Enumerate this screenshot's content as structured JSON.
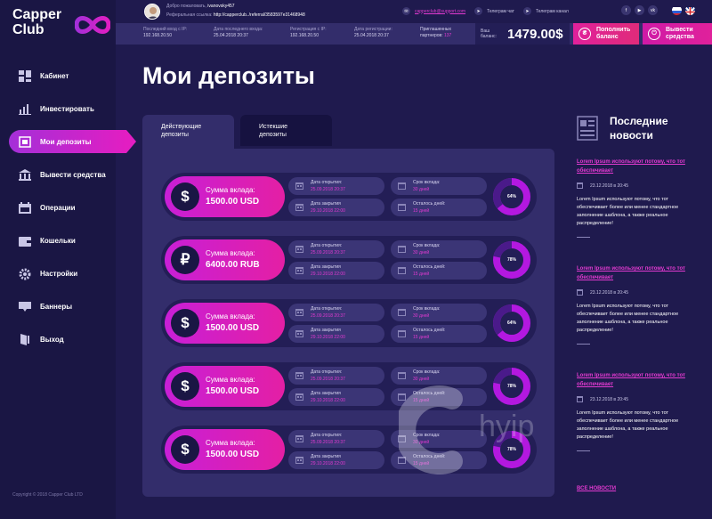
{
  "brand": {
    "line1": "Capper",
    "line2": "Club",
    "accent": "#e21ec2",
    "accent_purple": "#a42fd8"
  },
  "sidebar": {
    "items": [
      {
        "label": "Кабинет",
        "icon": "dashboard-icon",
        "active": false
      },
      {
        "label": "Инвестировать",
        "icon": "invest-icon",
        "active": false
      },
      {
        "label": "Мои депозиты",
        "icon": "deposits-icon",
        "active": true
      },
      {
        "label": "Вывести средства",
        "icon": "withdraw-icon",
        "active": false
      },
      {
        "label": "Операции",
        "icon": "operations-icon",
        "active": false
      },
      {
        "label": "Кошельки",
        "icon": "wallet-icon",
        "active": false
      },
      {
        "label": "Настройки",
        "icon": "gear-icon",
        "active": false
      },
      {
        "label": "Баннеры",
        "icon": "banner-icon",
        "active": false
      },
      {
        "label": "Выход",
        "icon": "logout-icon",
        "active": false
      }
    ],
    "copyright": "Copyright © 2018 Capper Club LTD"
  },
  "topbar": {
    "welcome_label": "Добро пожаловать,",
    "username": "ivanovsky457",
    "ref_label": "Реферальная ссылка:",
    "ref_url": "http://capperclub../referral/3583597e31468948",
    "email": "capperclub@support.com",
    "telegram_chat": "Телеграм чат",
    "telegram_channel": "Телеграм канал",
    "socials": [
      "f",
      "▶",
      "vk"
    ]
  },
  "stats": {
    "last_login_ip_label": "Последний вход с IP:",
    "last_login_ip": "192.168.20.50",
    "last_login_date_label": "Дата последнего входа:",
    "last_login_date": "25.04.2018   20:37",
    "reg_ip_label": "Регистрация с IP:",
    "reg_ip": "192.168.20.50",
    "reg_date_label": "Дата регистрации:",
    "reg_date": "25.04.2018   20:37",
    "partners_label1": "Приглашенных",
    "partners_label2": "партнеров:",
    "partners_count": "137",
    "balance_label1": "Ваш",
    "balance_label2": "баланс:",
    "balance_value": "1479.00$",
    "topup_label1": "Пополнить",
    "topup_label2": "баланс",
    "withdraw_label1": "Вывести",
    "withdraw_label2": "средства"
  },
  "main": {
    "title": "Мои депозиты",
    "tabs": [
      {
        "line1": "Действующие",
        "line2": "депозиты",
        "active": true
      },
      {
        "line1": "Истекшие",
        "line2": "депозиты",
        "active": false
      }
    ],
    "labels": {
      "amount": "Сумма вклада:",
      "open_date": "Дата открытия:",
      "close_date": "Дата закрытия",
      "term": "Срок вклада:",
      "days_left": "Осталось дней:"
    },
    "deposits": [
      {
        "currency_icon": "$",
        "amount": "1500.00 USD",
        "open": "25.09.2018  20:37",
        "close": "29.10.2018  22:00",
        "term": "30 дней",
        "left": "15 дней",
        "progress": 64,
        "progress_label": "64%"
      },
      {
        "currency_icon": "₽",
        "amount": "6400.00 RUB",
        "open": "25.09.2018  20:37",
        "close": "29.10.2018  22:00",
        "term": "30 дней",
        "left": "15 дней",
        "progress": 78,
        "progress_label": "78%"
      },
      {
        "currency_icon": "$",
        "amount": "1500.00 USD",
        "open": "25.09.2018  20:37",
        "close": "29.10.2018  22:00",
        "term": "30 дней",
        "left": "15 дней",
        "progress": 64,
        "progress_label": "64%"
      },
      {
        "currency_icon": "$",
        "amount": "1500.00 USD",
        "open": "25.09.2018  20:37",
        "close": "29.10.2018  22:00",
        "term": "30 дней",
        "left": "15 дней",
        "progress": 78,
        "progress_label": "78%"
      },
      {
        "currency_icon": "$",
        "amount": "1500.00 USD",
        "open": "25.09.2018  20:37",
        "close": "29.10.2018  22:00",
        "term": "30 дней",
        "left": "15 дней",
        "progress": 78,
        "progress_label": "78%"
      }
    ]
  },
  "news": {
    "title_line1": "Последние",
    "title_line2": "новости",
    "items": [
      {
        "headline": "Lorem Ipsum используют потому, что тот обеспечивает",
        "date": "23.12.2018 в 20:45",
        "text": "Lorem Ipsum используют потому, что тот обеспечивает более или менее стандартное заполнение шаблона, а также реальное распределение!"
      },
      {
        "headline": "Lorem Ipsum используют потому, что тот обеспечивает",
        "date": "23.12.2018 в 20:45",
        "text": "Lorem Ipsum используют потому, что тот обеспечивает более или менее стандартное заполнение шаблона, а также реальное распределение!"
      },
      {
        "headline": "Lorem Ipsum используют потому, что тот обеспечивает",
        "date": "23.12.2018 в 20:45",
        "text": "Lorem Ipsum используют потому, что тот обеспечивает более или менее стандартное заполнение шаблона, а также реальное распределение!"
      }
    ],
    "all_news": "ВСЕ НОВОСТИ"
  },
  "watermark": "hyip"
}
